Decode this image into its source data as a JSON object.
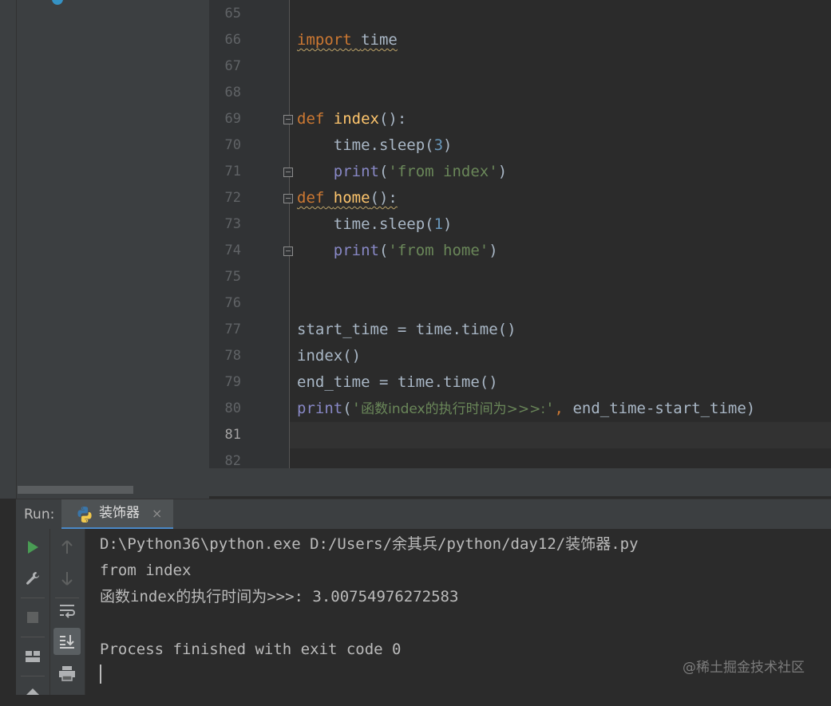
{
  "editor": {
    "current_line": "81",
    "lines": [
      {
        "num": "65",
        "segments": []
      },
      {
        "num": "66",
        "segments": [
          {
            "t": "import",
            "c": "kw sq"
          },
          {
            "t": " ",
            "c": "sq"
          },
          {
            "t": "time",
            "c": "sq"
          }
        ]
      },
      {
        "num": "67",
        "segments": []
      },
      {
        "num": "68",
        "segments": []
      },
      {
        "num": "69",
        "segments": [
          {
            "t": "def",
            "c": "kw"
          },
          {
            "t": " "
          },
          {
            "t": "index",
            "c": "fn"
          },
          {
            "t": "():"
          }
        ]
      },
      {
        "num": "70",
        "segments": [
          {
            "t": "    time.sleep("
          },
          {
            "t": "3",
            "c": "num"
          },
          {
            "t": ")"
          }
        ]
      },
      {
        "num": "71",
        "segments": [
          {
            "t": "    "
          },
          {
            "t": "print",
            "c": "builtin"
          },
          {
            "t": "("
          },
          {
            "t": "'from index'",
            "c": "str"
          },
          {
            "t": ")"
          }
        ]
      },
      {
        "num": "72",
        "segments": [
          {
            "t": "def",
            "c": "kw sq"
          },
          {
            "t": " ",
            "c": "sq"
          },
          {
            "t": "home",
            "c": "fn sq"
          },
          {
            "t": "():",
            "c": "sq"
          }
        ]
      },
      {
        "num": "73",
        "segments": [
          {
            "t": "    time.sleep("
          },
          {
            "t": "1",
            "c": "num"
          },
          {
            "t": ")"
          }
        ]
      },
      {
        "num": "74",
        "segments": [
          {
            "t": "    "
          },
          {
            "t": "print",
            "c": "builtin"
          },
          {
            "t": "("
          },
          {
            "t": "'from home'",
            "c": "str"
          },
          {
            "t": ")"
          }
        ]
      },
      {
        "num": "75",
        "segments": []
      },
      {
        "num": "76",
        "segments": []
      },
      {
        "num": "77",
        "segments": [
          {
            "t": "start_time = time.time()"
          }
        ]
      },
      {
        "num": "78",
        "segments": [
          {
            "t": "index()"
          }
        ]
      },
      {
        "num": "79",
        "segments": [
          {
            "t": "end_time = time.time()"
          }
        ]
      },
      {
        "num": "80",
        "segments": [
          {
            "t": "print",
            "c": "builtin"
          },
          {
            "t": "("
          },
          {
            "t": "'",
            "c": "str"
          },
          {
            "t": "函数index的执行时间为>>>:",
            "c": "str cjk"
          },
          {
            "t": "'",
            "c": "str"
          },
          {
            "t": ", ",
            "c": "kw"
          },
          {
            "t": "end_time-start_time)"
          }
        ]
      },
      {
        "num": "81",
        "segments": []
      },
      {
        "num": "82",
        "segments": []
      }
    ]
  },
  "run": {
    "label": "Run:",
    "tab_label": "装饰器",
    "tab_close": "×",
    "console_lines": [
      "D:\\Python36\\python.exe D:/Users/余其兵/python/day12/装饰器.py",
      "from index",
      "函数index的执行时间为>>>: 3.00754976272583",
      "",
      "Process finished with exit code 0"
    ]
  },
  "watermark": "@稀土掘金技术社区",
  "colors": {
    "keyword": "#cc7832",
    "function": "#ffc66d",
    "number": "#6897bb",
    "string": "#6a8759",
    "builtin": "#8888c6",
    "accent": "#4a88c7",
    "run_green": "#499c54"
  }
}
